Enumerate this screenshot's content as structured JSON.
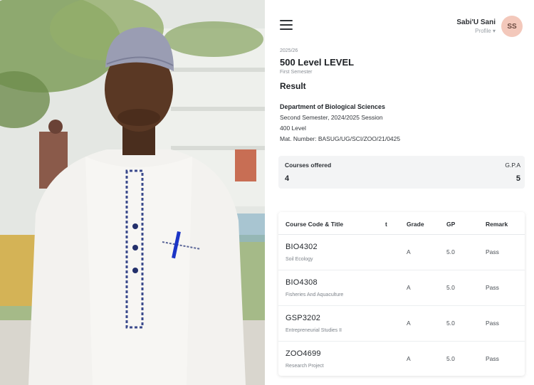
{
  "header": {
    "user_name": "Sabi'U Sani",
    "user_sub": "Profile ▾",
    "avatar_initials": "SS",
    "avatar_color": "#f3c8bb"
  },
  "page": {
    "session_small": "2025/26",
    "level_title": "500 Level LEVEL",
    "semester_small": "First Semester",
    "result_title": "Result"
  },
  "student": {
    "department": "Department of Biological Sciences",
    "session": "Second Semester, 2024/2025 Session",
    "level": "400 Level",
    "mat_number": "Mat. Number: BASUG/UG/SCI/ZOO/21/0425"
  },
  "summary": {
    "courses_label": "Courses offered",
    "courses_value": "4",
    "gpa_label": "G.P.A",
    "gpa_value": "5"
  },
  "table": {
    "headers": {
      "course": "Course Code & Title",
      "t": "t",
      "grade": "Grade",
      "gp": "GP",
      "remark": "Remark"
    },
    "rows": [
      {
        "code": "BIO4302",
        "title": "Soil Ecology",
        "grade": "A",
        "gp": "5.0",
        "remark": "Pass"
      },
      {
        "code": "BIO4308",
        "title": "Fisheries And Aquaculture",
        "grade": "A",
        "gp": "5.0",
        "remark": "Pass"
      },
      {
        "code": "GSP3202",
        "title": "Entrepreneurial Studies II",
        "grade": "A",
        "gp": "5.0",
        "remark": "Pass"
      },
      {
        "code": "ZOO4699",
        "title": "Research Project",
        "grade": "A",
        "gp": "5.0",
        "remark": "Pass"
      }
    ]
  }
}
